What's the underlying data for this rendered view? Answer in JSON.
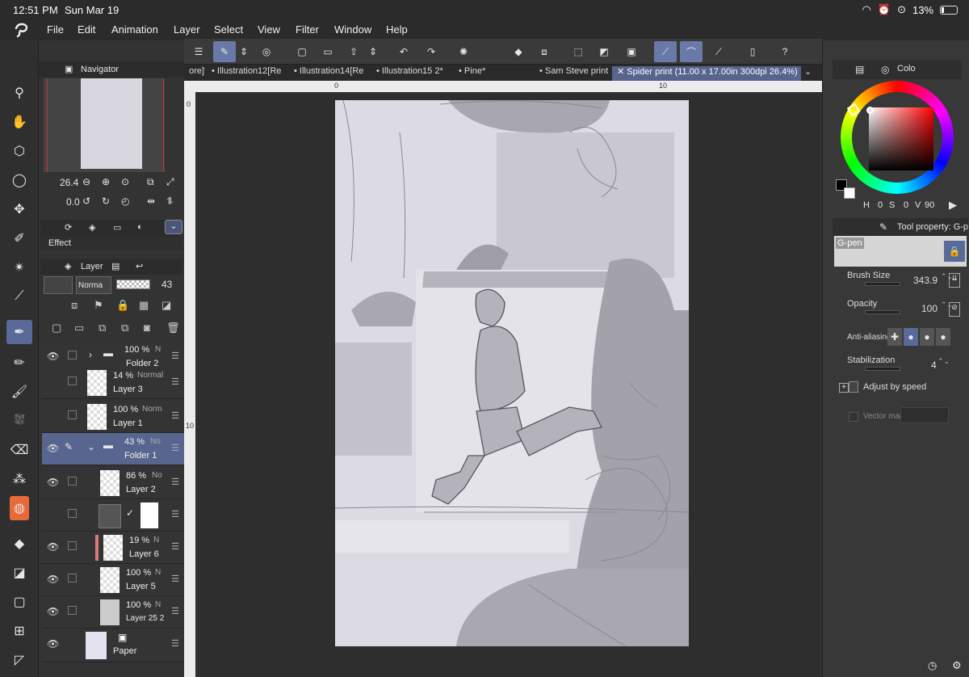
{
  "status": {
    "time": "12:51 PM",
    "date": "Sun Mar 19",
    "battery": "13%"
  },
  "menu": [
    "File",
    "Edit",
    "Animation",
    "Layer",
    "Select",
    "View",
    "Filter",
    "Window",
    "Help"
  ],
  "tabs": [
    {
      "label": "ore]*",
      "active": false
    },
    {
      "label": "Illustration12[Re",
      "active": false
    },
    {
      "label": "Illustration14[Re",
      "active": false
    },
    {
      "label": "Illustration15 2*",
      "active": false
    },
    {
      "label": "Pine*",
      "active": false
    },
    {
      "label": "Sam Steve print",
      "active": false
    },
    {
      "label": "Spider print (11.00 x 17.00in 300dpi 26.4%)",
      "active": true
    }
  ],
  "ruler": {
    "top_labels": [
      "0",
      "10"
    ],
    "left_labels": [
      "0",
      "10"
    ]
  },
  "navigator": {
    "title": "Navigator",
    "zoom": "26.4",
    "rotation": "0.0"
  },
  "effect": {
    "title": "Effect"
  },
  "layer_panel": {
    "title": "Layer",
    "blend_mode": "Norma",
    "opacity": "43"
  },
  "layers": [
    {
      "pct": "100 %",
      "mode": "N",
      "name": "Folder 2",
      "type": "folder",
      "visible": true,
      "selected": false
    },
    {
      "pct": "14 %",
      "mode": "Normal",
      "name": "Layer 3",
      "type": "layer",
      "visible": false,
      "selected": false
    },
    {
      "pct": "100 %",
      "mode": "Norm",
      "name": "Layer 1",
      "type": "layer",
      "visible": false,
      "selected": false
    },
    {
      "pct": "43 %",
      "mode": "No",
      "name": "Folder 1",
      "type": "folder",
      "visible": true,
      "selected": true
    },
    {
      "pct": "86 %",
      "mode": "No",
      "name": "Layer 2",
      "type": "layer",
      "visible": true,
      "selected": false
    },
    {
      "pct": "",
      "mode": "",
      "name": "",
      "type": "mask",
      "visible": false,
      "selected": false
    },
    {
      "pct": "19 %",
      "mode": "N",
      "name": "Layer 6",
      "type": "layer",
      "visible": true,
      "selected": false
    },
    {
      "pct": "100 %",
      "mode": "N",
      "name": "Layer 5",
      "type": "layer",
      "visible": true,
      "selected": false
    },
    {
      "pct": "100 %",
      "mode": "N",
      "name": "Layer 25 2",
      "type": "layer",
      "visible": true,
      "selected": false
    },
    {
      "pct": "",
      "mode": "",
      "name": "Paper",
      "type": "paper",
      "visible": true,
      "selected": false
    }
  ],
  "color_panel": {
    "tab": "Colo",
    "h": "0",
    "s": "0",
    "v": "90",
    "h_label": "H",
    "s_label": "S",
    "v_label": "V"
  },
  "tool_property": {
    "title": "Tool property: G-p",
    "brush_name": "G-pen",
    "brush_size_label": "Brush Size",
    "brush_size": "343.9",
    "opacity_label": "Opacity",
    "opacity": "100",
    "antialias_label": "Anti-aliasing",
    "stabilization_label": "Stabilization",
    "stabilization": "4",
    "adjust_label": "Adjust by speed",
    "vector_label": "Vector mag"
  },
  "colors": {
    "accent": "#5a6a98",
    "panel": "#333333",
    "bg": "#2e2e2e"
  }
}
